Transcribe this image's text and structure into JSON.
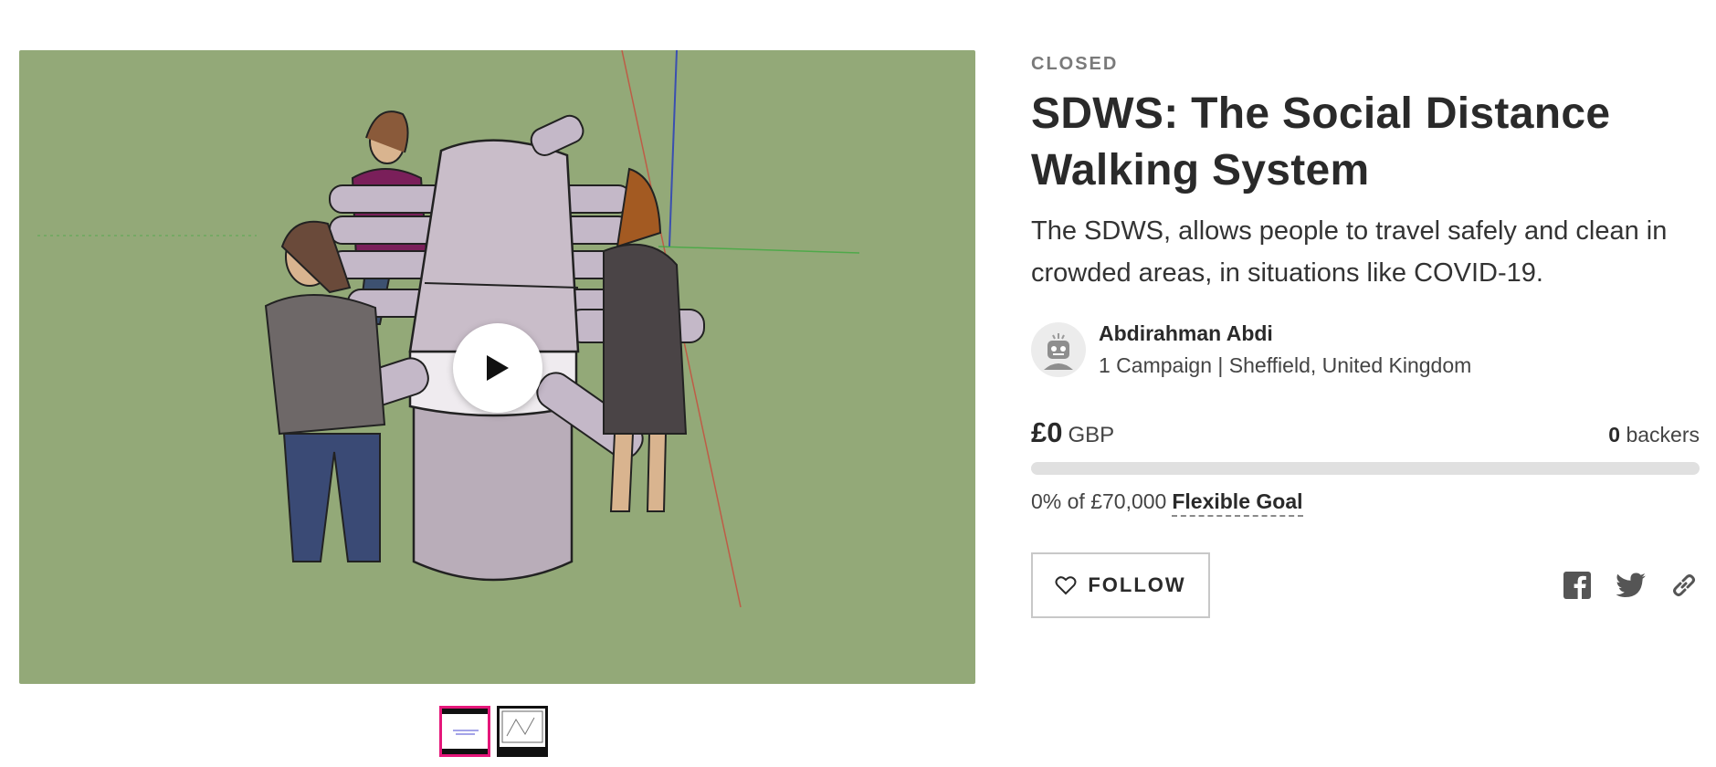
{
  "campaign": {
    "status": "CLOSED",
    "title": "SDWS: The Social Distance Walking System",
    "tagline": "The SDWS, allows people to travel safely and clean in crowded areas, in situations like COVID-19."
  },
  "owner": {
    "name": "Abdirahman Abdi",
    "meta": "1 Campaign | Sheffield, United Kingdom"
  },
  "funding": {
    "raised": "£0",
    "currency": "GBP",
    "backers_count": "0",
    "backers_label": "backers",
    "progress_percent": 0,
    "goal_text": "0% of £70,000",
    "goal_type": "Flexible Goal"
  },
  "actions": {
    "follow_label": "FOLLOW"
  },
  "media": {
    "background_color": "#93a978",
    "play_icon": "play-icon",
    "thumbnail_count": 2,
    "active_thumbnail": 0,
    "active_border_color": "#e5177a"
  },
  "share_icons": [
    "facebook-icon",
    "twitter-icon",
    "link-icon"
  ]
}
